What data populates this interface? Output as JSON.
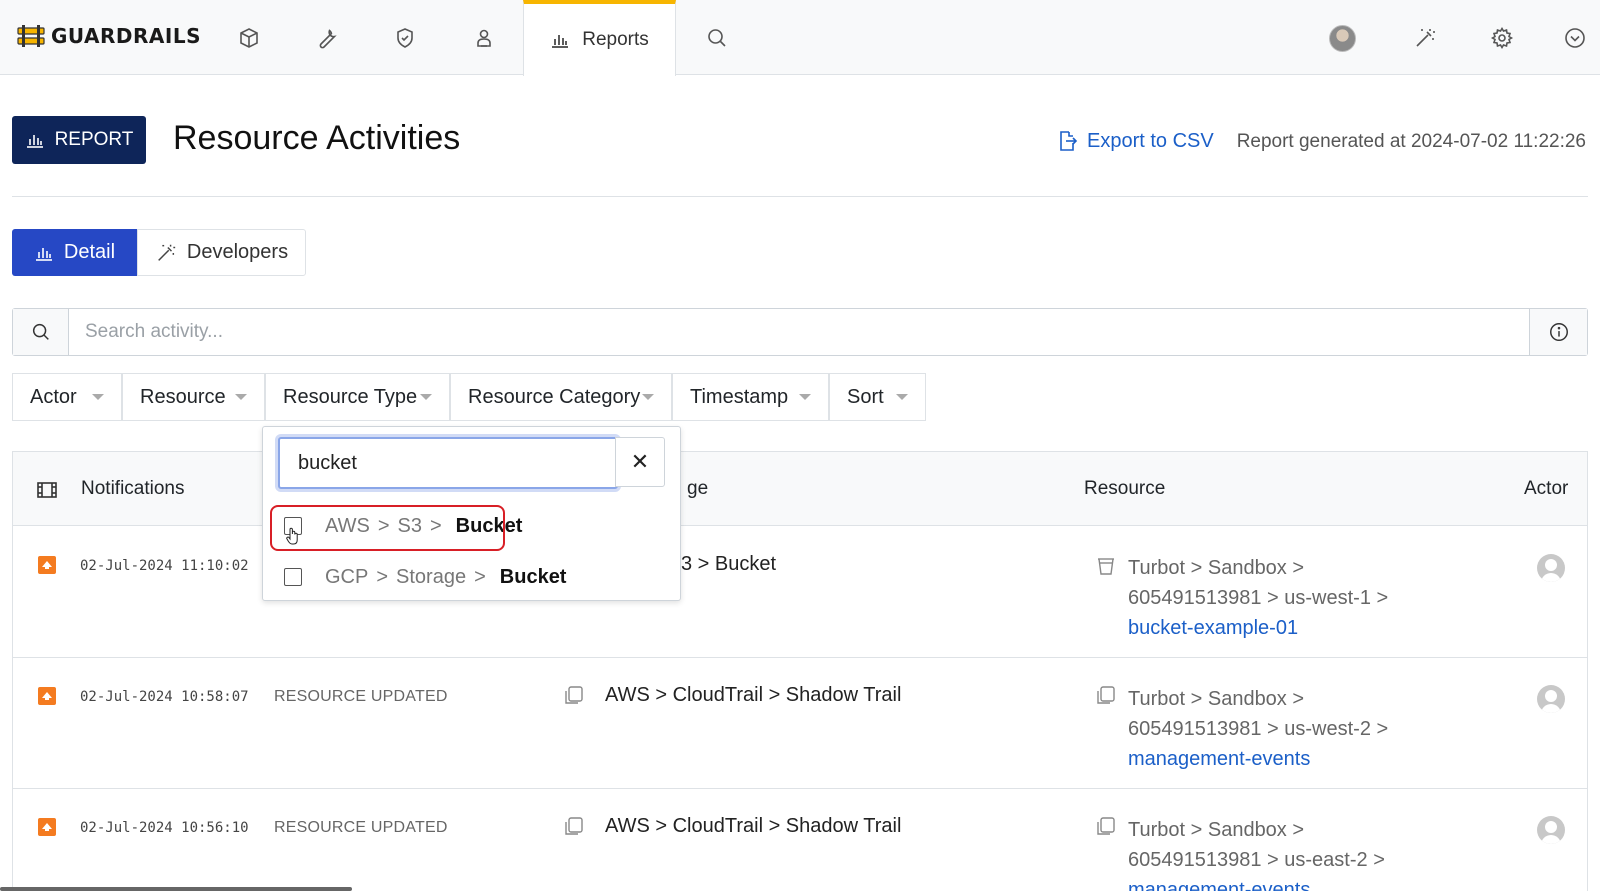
{
  "nav": {
    "logo_text": "GUARDRAILS",
    "icons": [
      "cube-icon",
      "wrench-icon",
      "shield-check-icon",
      "person-badge-icon"
    ],
    "reports_label": "Reports",
    "right_icons": [
      "avatar",
      "magic-wand-icon",
      "gear-icon",
      "chevron-circle-down-icon"
    ],
    "accent": "#f7b500"
  },
  "header": {
    "badge": "REPORT",
    "title": "Resource Activities",
    "export": "Export to CSV",
    "generated": "Report generated at 2024-07-02 11:22:26"
  },
  "tabs": {
    "detail": "Detail",
    "developers": "Developers"
  },
  "search": {
    "placeholder": "Search activity..."
  },
  "filters": [
    "Actor",
    "Resource",
    "Resource Type",
    "Resource Category",
    "Timestamp",
    "Sort"
  ],
  "table": {
    "headers": {
      "notifications": "Notifications",
      "type_fragment": "ge",
      "resource": "Resource",
      "actor": "Actor"
    },
    "rows": [
      {
        "timestamp": "02-Jul-2024 11:10:02",
        "event": "",
        "type": "3 > Bucket",
        "resource_path_1": "Turbot > Sandbox >",
        "resource_path_2": "605491513981 > us-west-1 >",
        "resource_link": "bucket-example-01"
      },
      {
        "timestamp": "02-Jul-2024 10:58:07",
        "event": "RESOURCE UPDATED",
        "type": "AWS > CloudTrail > Shadow Trail",
        "resource_path_1": "Turbot > Sandbox >",
        "resource_path_2": "605491513981 > us-west-2 >",
        "resource_link": "management-events"
      },
      {
        "timestamp": "02-Jul-2024 10:56:10",
        "event": "RESOURCE UPDATED",
        "type": "AWS > CloudTrail > Shadow Trail",
        "resource_path_1": "Turbot > Sandbox >",
        "resource_path_2": "605491513981 > us-east-2 >",
        "resource_link": "management-events"
      }
    ]
  },
  "dropdown": {
    "query": "bucket",
    "clear": "✕",
    "options": [
      {
        "p1": "AWS",
        "p2": "S3",
        "leaf": "Bucket"
      },
      {
        "p1": "GCP",
        "p2": "Storage",
        "leaf": "Bucket"
      }
    ],
    "sep": ">"
  }
}
